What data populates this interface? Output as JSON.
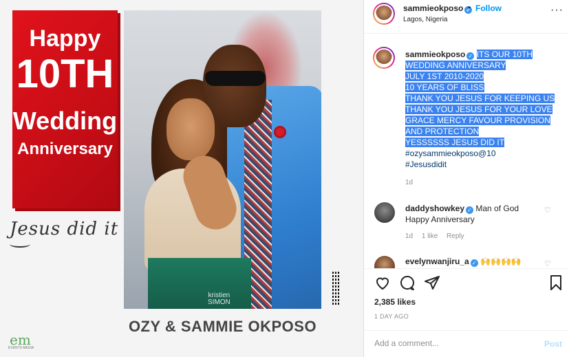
{
  "post_image": {
    "banner": {
      "line1": "Happy",
      "line2": "10TH",
      "line3": "Wedding",
      "line4": "Anniversary"
    },
    "tagline": "Jesus did it",
    "couple_name": "OZY & SAMMIE OKPOSO",
    "photographer_watermark": "kristien\nSIMON",
    "brand_logo": "em",
    "brand_sub": "EVENTS MEDIA"
  },
  "header": {
    "username": "sammieokposo",
    "verified_icon": "verified-check-icon",
    "dot": "•",
    "follow_label": "Follow",
    "location": "Lagos, Nigeria",
    "more_icon": "more-horizontal-icon",
    "more_label": "···"
  },
  "caption": {
    "username": "sammieokposo",
    "lines": [
      "ITS OUR 10TH",
      "WEDDING ANNIVERSARY",
      "JULY 1ST 2010-2020",
      "10 YEARS OF BLISS",
      "THANK YOU JESUS FOR KEEPING US",
      "THANK YOU JESUS FOR YOUR LOVE",
      "GRACE MERCY FAVOUR PROVISION",
      "AND PROTECTION",
      "YESSSSSS JESUS DID IT"
    ],
    "hashtags": [
      "#ozysammieokposo@10",
      "#Jesusdidit"
    ],
    "time": "1d"
  },
  "comments": [
    {
      "username": "daddyshowkey",
      "text_line1": "Man of God",
      "text_line2": "Happy Anniversary",
      "time": "1d",
      "likes": "1 like",
      "reply": "Reply"
    },
    {
      "username": "evelynwanjiru_a",
      "text": "🙌🙌🙌🙌"
    }
  ],
  "actions": {
    "like_icon": "heart-icon",
    "comment_icon": "comment-icon",
    "share_icon": "paper-plane-icon",
    "save_icon": "bookmark-icon"
  },
  "likes_count": "2,385 likes",
  "date": "1 DAY AGO",
  "add_comment": {
    "placeholder": "Add a comment...",
    "post_label": "Post"
  },
  "colors": {
    "accent": "#0095f6",
    "highlight": "#3b83f0",
    "banner_red": "#e0121b"
  }
}
